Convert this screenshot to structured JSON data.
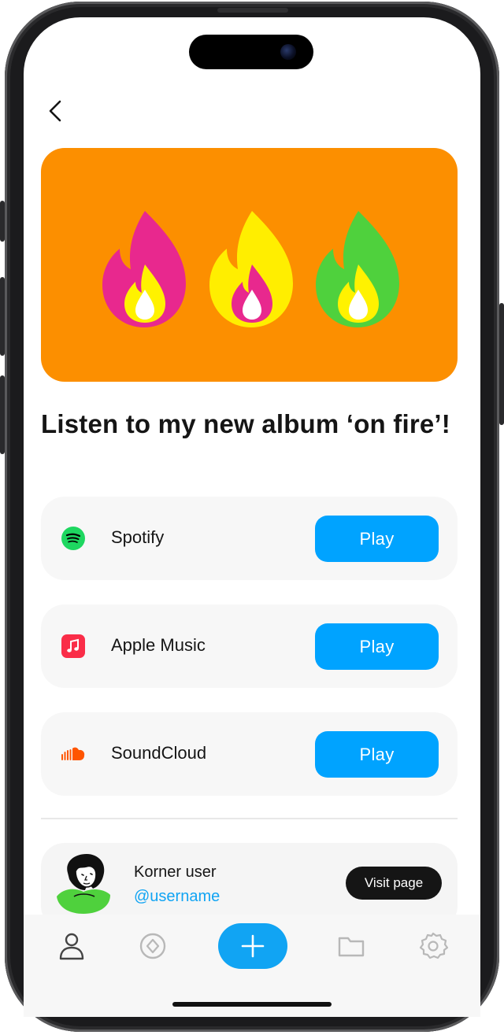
{
  "hero": {
    "banner_color": "#fc8f00",
    "flames": [
      "pink-flame-icon",
      "yellow-flame-icon",
      "green-flame-icon"
    ]
  },
  "headline": "Listen to my new album ‘on fire’!",
  "services": [
    {
      "name": "Spotify",
      "icon": "spotify-icon",
      "button": "Play"
    },
    {
      "name": "Apple Music",
      "icon": "apple-music-icon",
      "button": "Play"
    },
    {
      "name": "SoundCloud",
      "icon": "soundcloud-icon",
      "button": "Play"
    }
  ],
  "profile": {
    "name": "Korner user",
    "handle": "@username",
    "button": "Visit page",
    "avatar": "avatar-illustration"
  },
  "tabbar": {
    "items": [
      "profile-icon",
      "compass-icon",
      "add-icon",
      "folder-icon",
      "settings-icon"
    ]
  },
  "colors": {
    "accent": "#00a3ff",
    "spotify": "#1ed760",
    "apple_music": "#fa2d48",
    "soundcloud": "#ff5500"
  }
}
